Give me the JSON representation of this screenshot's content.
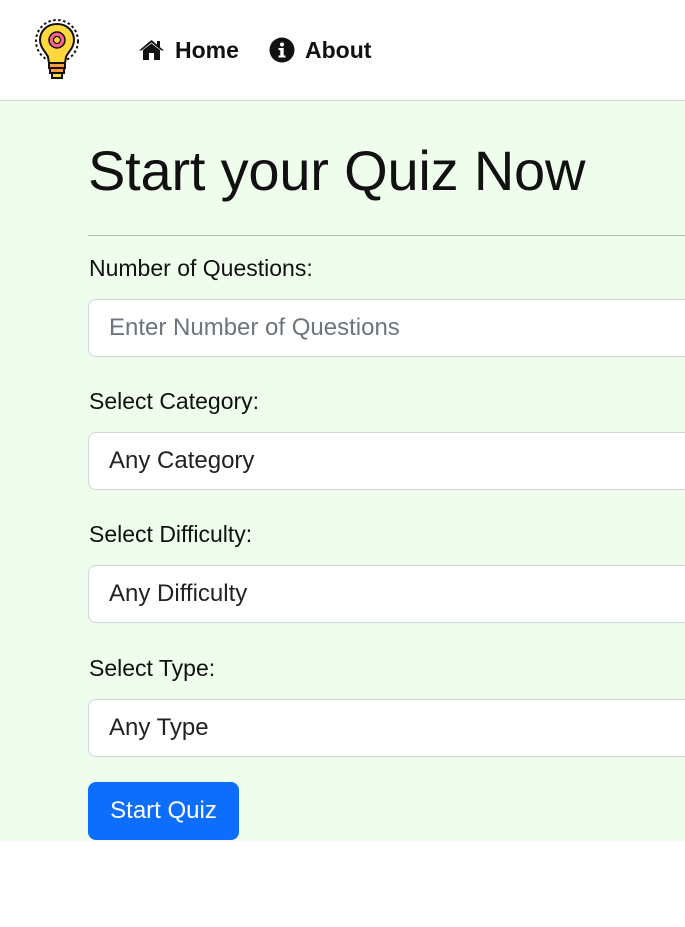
{
  "nav": {
    "home_label": "Home",
    "about_label": "About",
    "home_icon": "home-icon",
    "about_icon": "info-circle-icon",
    "logo_icon": "lightbulb-gear-icon"
  },
  "main": {
    "title": "Start your Quiz Now",
    "background_color": "#effdec",
    "questions": {
      "label": "Number of Questions:",
      "placeholder": "Enter Number of Questions",
      "value": ""
    },
    "category": {
      "label": "Select Category:",
      "selected": "Any Category"
    },
    "difficulty": {
      "label": "Select Difficulty:",
      "selected": "Any Difficulty"
    },
    "type": {
      "label": "Select Type:",
      "selected": "Any Type"
    },
    "start_button": {
      "label": "Start Quiz",
      "color": "#0d6efd"
    }
  }
}
